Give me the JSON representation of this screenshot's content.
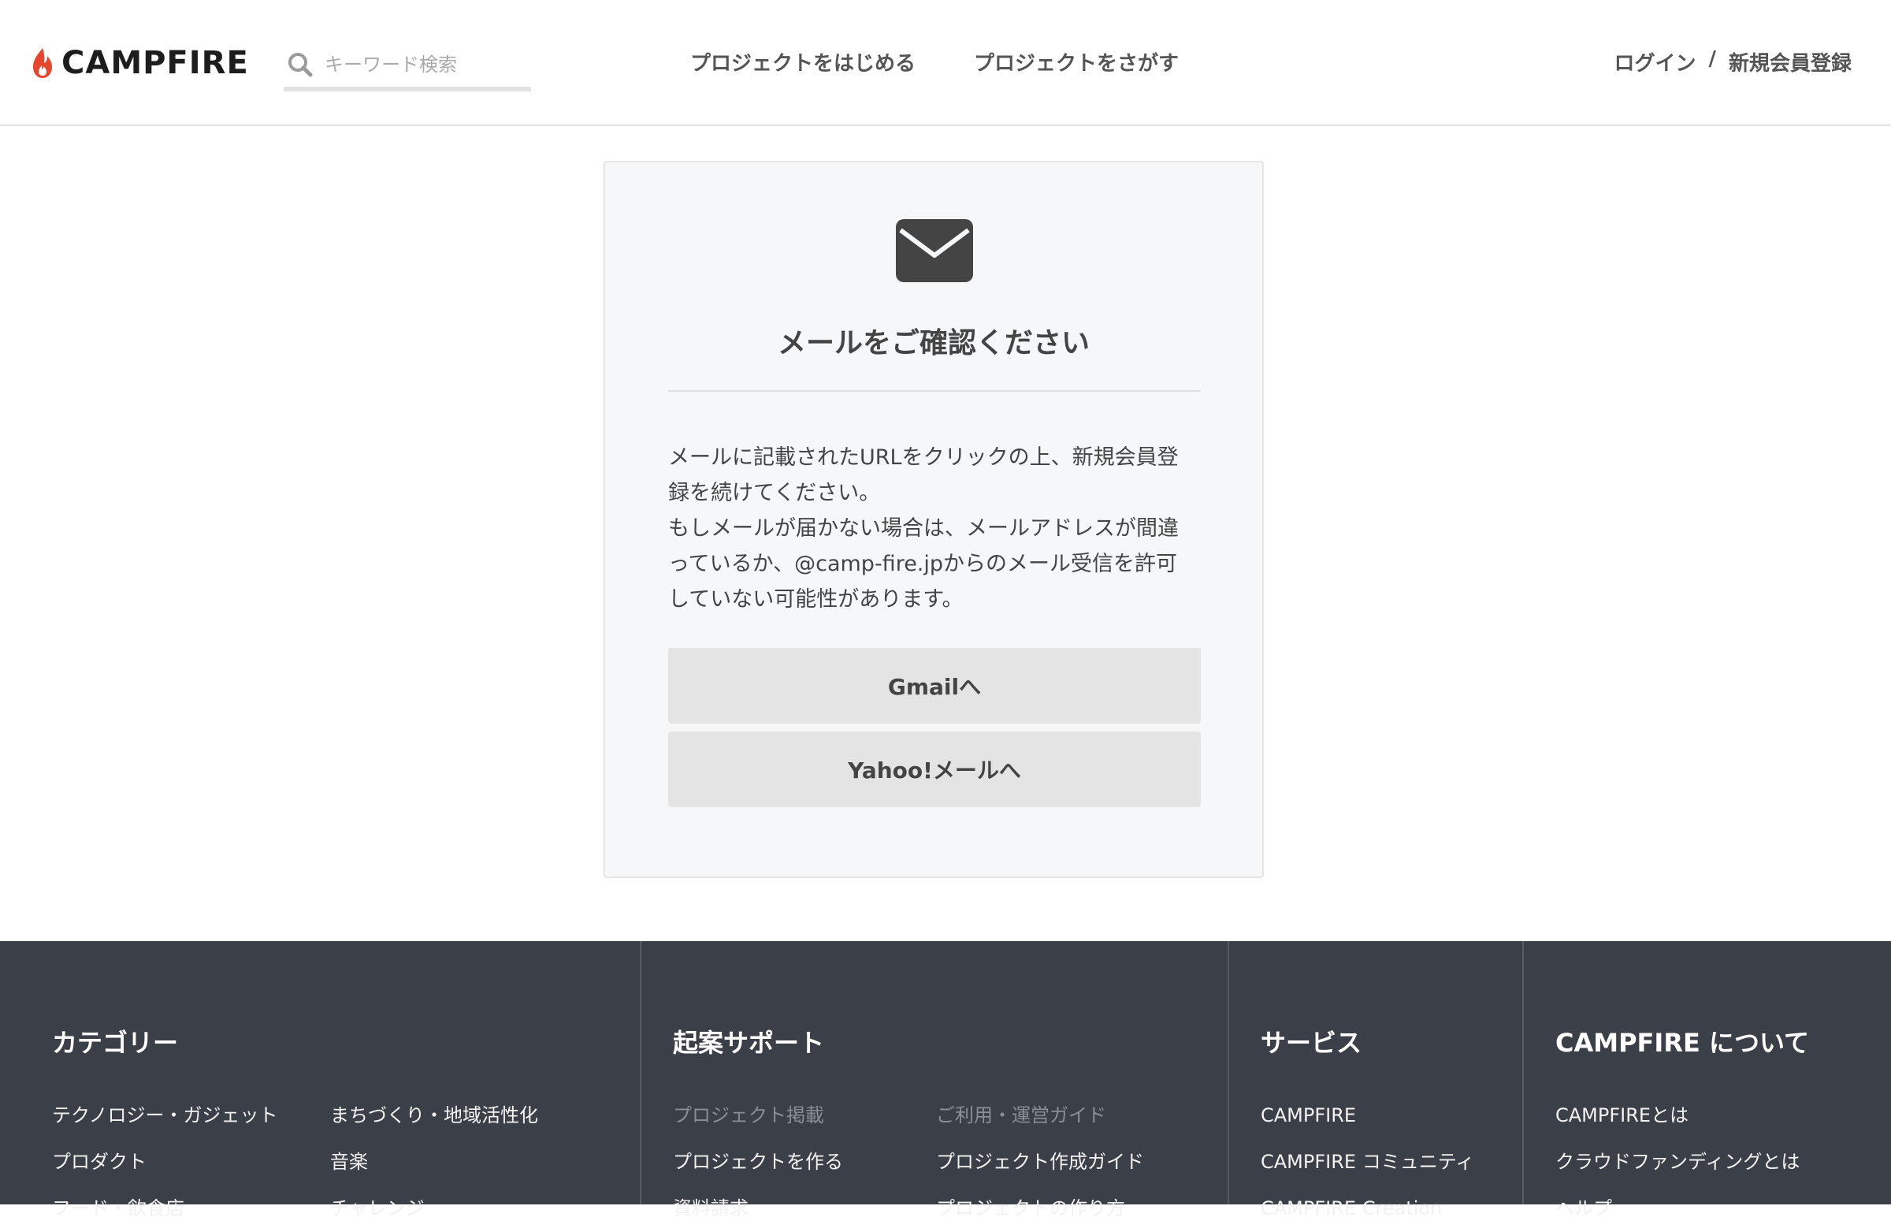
{
  "header": {
    "logo_text": "CAMPFIRE",
    "search_placeholder": "キーワード検索",
    "nav": [
      "プロジェクトをはじめる",
      "プロジェクトをさがす"
    ],
    "login": "ログイン",
    "auth_sep": "/",
    "signup": "新規会員登録"
  },
  "card": {
    "icon": "mail-icon",
    "title": "メールをご確認ください",
    "body_lines": [
      "メールに記載されたURLをクリックの上、新規会員登",
      "録を続けてください。",
      "もしメールが届かない場合は、メールアドレスが間違",
      "っているか、@camp-fire.jpからのメール受信を許可",
      "していない可能性があります。"
    ],
    "gmail_button": "Gmailへ",
    "yahoo_button": "Yahoo!メールへ"
  },
  "footer": {
    "category": {
      "title": "カテゴリー",
      "col1": [
        "テクノロジー・ガジェット",
        "プロダクト",
        "フード・飲食店"
      ],
      "col2": [
        "まちづくり・地域活性化",
        "音楽",
        "チャレンジ"
      ]
    },
    "support": {
      "title": "起案サポート",
      "col1": [
        "プロジェクト掲載",
        "プロジェクトを作る",
        "資料請求"
      ],
      "col2": [
        "ご利用・運営ガイド",
        "プロジェクト作成ガイド",
        "プロジェクトの作り方"
      ]
    },
    "services": {
      "title": "サービス",
      "items": [
        "CAMPFIRE",
        "CAMPFIRE コミュニティ",
        "CAMPFIRE Creation"
      ]
    },
    "about": {
      "title": "CAMPFIRE について",
      "items": [
        "CAMPFIREとは",
        "クラウドファンディングとは",
        "ヘルプ"
      ]
    }
  },
  "colors": {
    "brand_flame": "#e8452c",
    "footer_bg": "#3b3f47",
    "card_bg": "#f6f7f8",
    "button_bg": "#e4e4e4"
  }
}
